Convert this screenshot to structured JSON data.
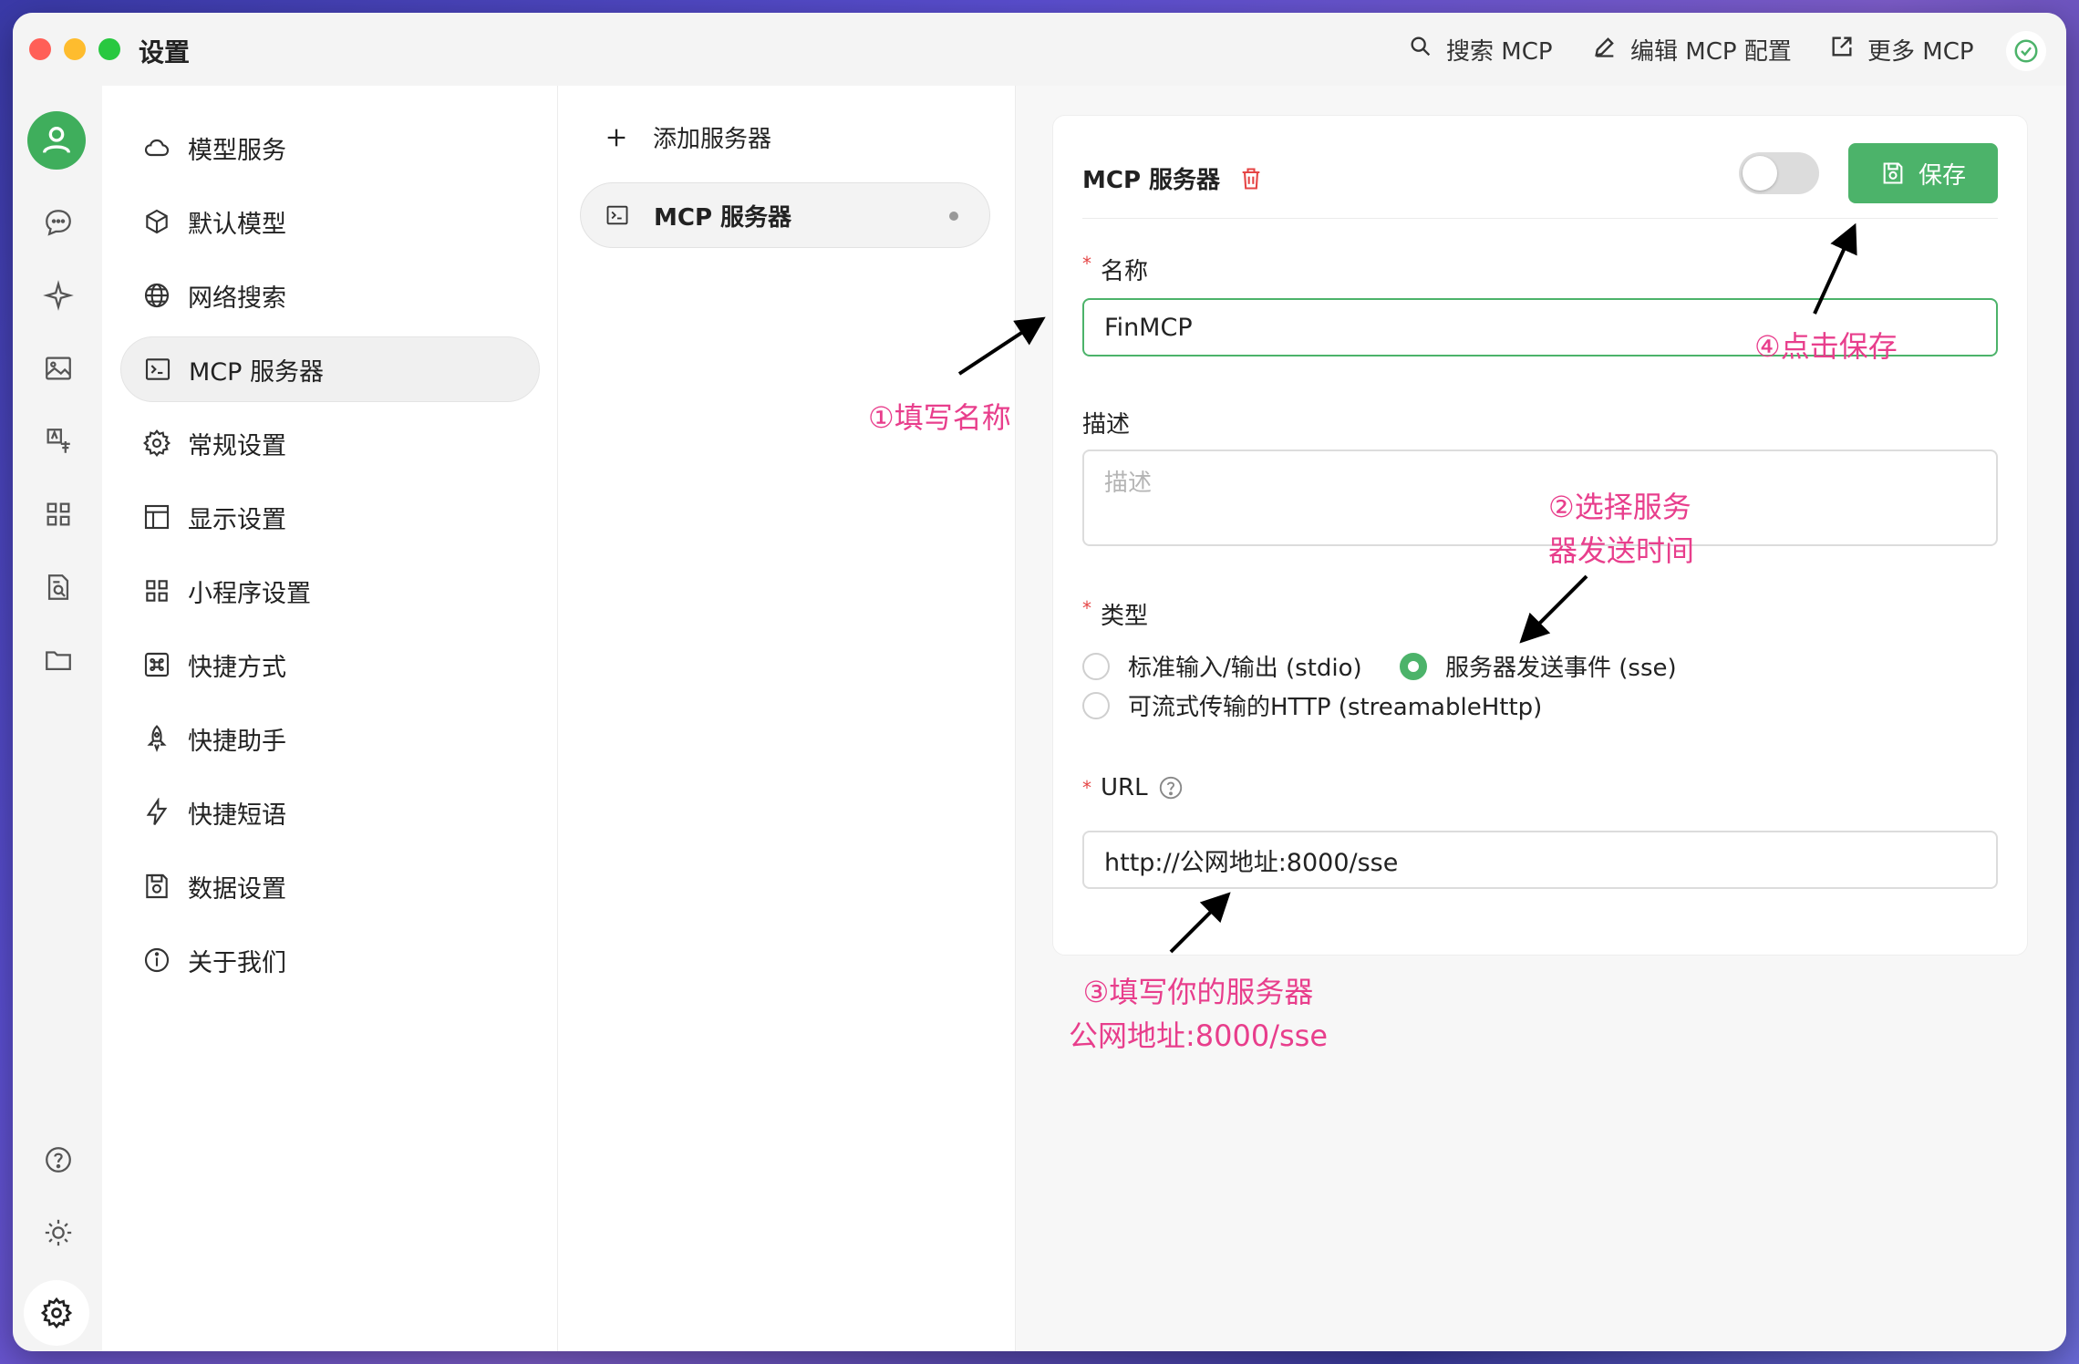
{
  "window": {
    "title": "设置",
    "actions": [
      {
        "label": "搜索 MCP",
        "icon": "search-icon"
      },
      {
        "label": "编辑 MCP 配置",
        "icon": "pencil-icon"
      },
      {
        "label": "更多 MCP",
        "icon": "external-link-icon"
      }
    ]
  },
  "rail": {
    "items": [
      "avatar-icon",
      "chat-icon",
      "sparkle-icon",
      "image-icon",
      "translate-icon",
      "apps-icon",
      "document-search-icon",
      "folder-icon"
    ],
    "bottom": [
      "help-icon",
      "sun-icon",
      "gear-icon"
    ]
  },
  "menu": {
    "items": [
      {
        "label": "模型服务",
        "icon": "cloud-icon"
      },
      {
        "label": "默认模型",
        "icon": "cube-icon"
      },
      {
        "label": "网络搜索",
        "icon": "globe-icon"
      },
      {
        "label": "MCP 服务器",
        "icon": "terminal-icon"
      },
      {
        "label": "常规设置",
        "icon": "gear-icon"
      },
      {
        "label": "显示设置",
        "icon": "layout-icon"
      },
      {
        "label": "小程序设置",
        "icon": "grid-icon"
      },
      {
        "label": "快捷方式",
        "icon": "command-icon"
      },
      {
        "label": "快捷助手",
        "icon": "rocket-icon"
      },
      {
        "label": "快捷短语",
        "icon": "bolt-icon"
      },
      {
        "label": "数据设置",
        "icon": "save-icon"
      },
      {
        "label": "关于我们",
        "icon": "info-icon"
      }
    ],
    "active_index": 3
  },
  "servers": {
    "add_label": "添加服务器",
    "items": [
      {
        "label": "MCP 服务器"
      }
    ]
  },
  "detail": {
    "title": "MCP 服务器",
    "save_label": "保存",
    "name_label": "名称",
    "name_value": "FinMCP",
    "desc_label": "描述",
    "desc_placeholder": "描述",
    "type_label": "类型",
    "types": [
      {
        "label": "标准输入/输出 (stdio)",
        "selected": false
      },
      {
        "label": "服务器发送事件 (sse)",
        "selected": true
      },
      {
        "label": "可流式传输的HTTP (streamableHttp)",
        "selected": false
      }
    ],
    "url_label": "URL",
    "url_value": "http://公网地址:8000/sse"
  },
  "annotations": {
    "a1": "①填写名称",
    "a2_line1": "②选择服务",
    "a2_line2": "器发送时间",
    "a3_line1": "③填写你的服务器",
    "a3_line2": "公网地址:8000/sse",
    "a4": "④点击保存",
    "color": "#e83e8c"
  }
}
